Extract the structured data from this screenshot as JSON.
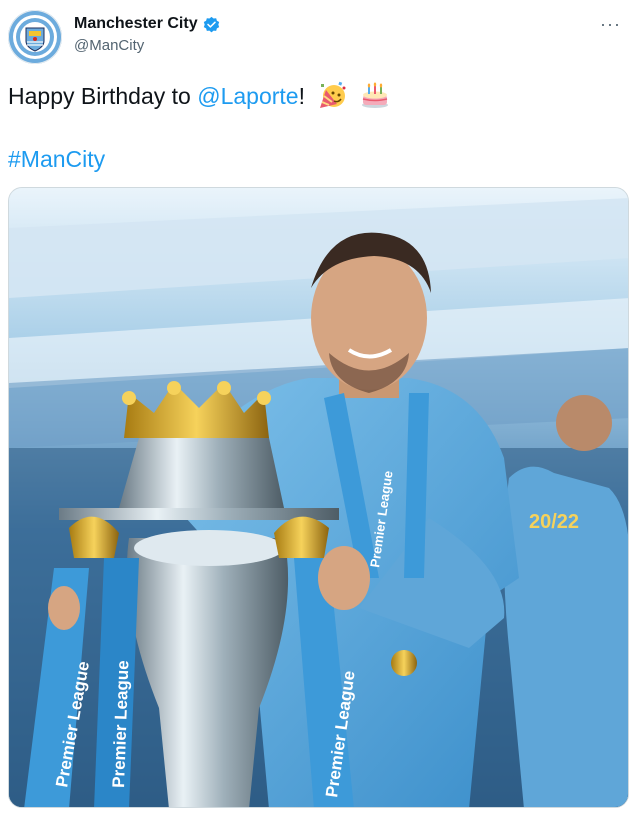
{
  "account": {
    "display_name": "Manchester City",
    "handle": "@ManCity",
    "verified": true,
    "avatar_icon": "man-city-crest-icon"
  },
  "menu": {
    "more_label": "···"
  },
  "tweet": {
    "text_prefix": "Happy Birthday to ",
    "mention": "@Laporte",
    "text_suffix": "!",
    "emojis": [
      "partying-face-emoji",
      "birthday-cake-emoji"
    ],
    "hashtag": "#ManCity"
  },
  "media": {
    "type": "photo",
    "subject": "player with Premier League trophy",
    "ribbon_text": "Premier League",
    "back_text": "20/22"
  },
  "colors": {
    "link": "#1d9bf0",
    "verified": "#1d9bf0",
    "city_blue": "#6cabdd",
    "secondary_text": "#536471"
  }
}
